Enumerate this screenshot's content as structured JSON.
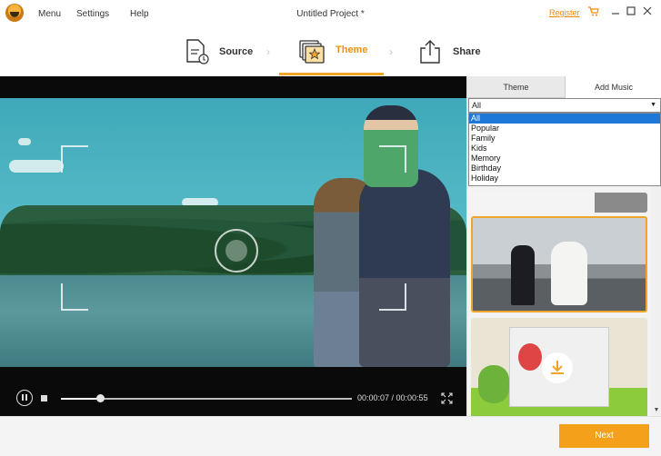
{
  "titlebar": {
    "menu": [
      "Menu",
      "Settings",
      "Help"
    ],
    "title": "Untitled Project *",
    "register": "Register",
    "icons": [
      "cart-icon",
      "minimize-icon",
      "maximize-icon",
      "close-icon"
    ]
  },
  "steps": [
    {
      "label": "Source",
      "icon": "source-file-icon",
      "active": false
    },
    {
      "label": "Theme",
      "icon": "theme-star-icon",
      "active": true
    },
    {
      "label": "Share",
      "icon": "share-upload-icon",
      "active": false
    }
  ],
  "player": {
    "time": "00:00:07 / 00:00:55",
    "progress": 0.135
  },
  "panel": {
    "tabs": [
      "Theme",
      "Add Music"
    ],
    "select_value": "All",
    "options": [
      "All",
      "Popular",
      "Family",
      "Kids",
      "Memory",
      "Birthday",
      "Holiday"
    ],
    "selected_index": 0
  },
  "footer": {
    "next_label": "Next"
  },
  "colors": {
    "accent": "#f5a01b",
    "link": "#f08c00",
    "selection": "#1e78d7"
  }
}
